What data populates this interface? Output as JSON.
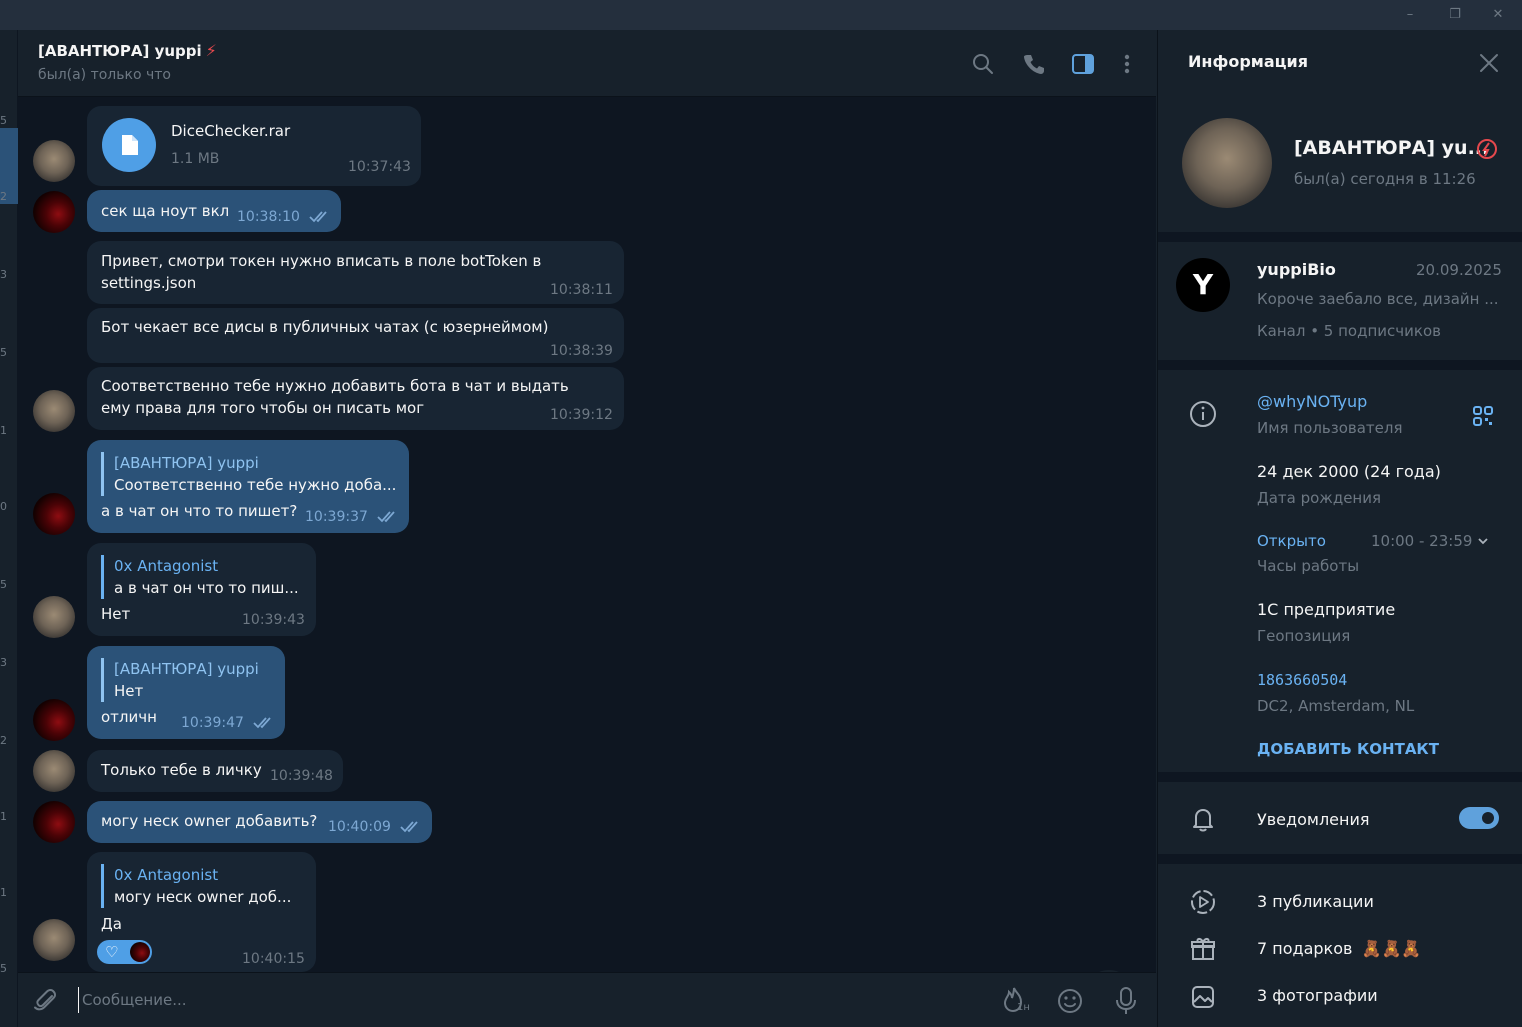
{
  "window": {
    "minimize": "–",
    "restore": "❐",
    "close": "✕"
  },
  "sidebar_strip": {
    "numbers": [
      "5",
      "2",
      "3",
      "5",
      "1",
      "0",
      "5",
      "3",
      "2",
      "1",
      "1",
      "5"
    ]
  },
  "chat_header": {
    "title": "[АВАНТЮРА] yuppi",
    "title_emoji": "⚡",
    "status": "был(а) только что",
    "icons": [
      "search-icon",
      "phone-icon",
      "sidebar-toggle-icon",
      "more-vertical-icon"
    ]
  },
  "messages": [
    {
      "file_name": "DiceChecker.rar",
      "file_size": "1.1 MB",
      "time": "10:37:43"
    },
    {
      "text": "сек ща ноут вкл",
      "time": "10:38:10"
    },
    {
      "text": "Привет, смотри токен нужно вписать в поле botToken в settings.json",
      "time": "10:38:11"
    },
    {
      "text": "Бот чекает все дисы в публичных чатах (с юзернеймом)",
      "time": "10:38:39"
    },
    {
      "text": "Соответственно тебе нужно добавить бота в чат и выдать ему права для того чтобы он писать мог",
      "time": "10:39:12"
    },
    {
      "reply_name": "[АВАНТЮРА] yuppi",
      "reply_text": "Соответственно тебе нужно доба...",
      "text": "а в чат он что то пишет?",
      "time": "10:39:37"
    },
    {
      "reply_name": "0x Antagonist",
      "reply_text": "а в чат он что то пиш...",
      "text": "Нет",
      "time": "10:39:43"
    },
    {
      "reply_name": "[АВАНТЮРА] yuppi",
      "reply_text": "Нет",
      "text": "отличн",
      "time": "10:39:47"
    },
    {
      "text": "Только тебе в личку",
      "time": "10:39:48"
    },
    {
      "text": "могу неск owner добавить?",
      "time": "10:40:09"
    },
    {
      "reply_name": "0x Antagonist",
      "reply_text": "могу неск owner доб...",
      "text": "Да",
      "time": "10:40:15",
      "reaction": "♡"
    }
  ],
  "composer": {
    "placeholder": "Сообщение...",
    "timer_label": "1н"
  },
  "info_panel": {
    "title": "Информация",
    "profile_name": "[АВАНТЮРА] yu...",
    "profile_status": "был(а) сегодня в 11:26",
    "channel": {
      "avatar_letter": "Y",
      "name": "yuppiBio",
      "date": "20.09.2025",
      "preview": "Короче заебало все, дизайн ...",
      "meta": "Канал • 5 подписчиков"
    },
    "username": "@whyNOTyup",
    "username_label": "Имя пользователя",
    "birthday": "24 дек 2000 (24 года)",
    "birthday_label": "Дата рождения",
    "hours_status": "Открыто",
    "hours_range": "10:00 - 23:59",
    "hours_label": "Часы работы",
    "location": "1С предприятие",
    "location_label": "Геопозиция",
    "user_id": "1863660504",
    "dc": "DC2, Amsterdam, NL",
    "add_contact": "ДОБАВИТЬ КОНТАКТ",
    "notifications": "Уведомления",
    "notifications_on": true,
    "posts": "3 публикации",
    "gifts": "7 подарков",
    "gift_emojis": "🧸🧸🧸",
    "photos": "3 фотографии"
  },
  "colors": {
    "bg": "#0e1621",
    "panel": "#17212b",
    "bubble_in": "#182533",
    "bubble_out": "#2b5278",
    "accent": "#6ab2f2",
    "muted": "#6d7883"
  }
}
